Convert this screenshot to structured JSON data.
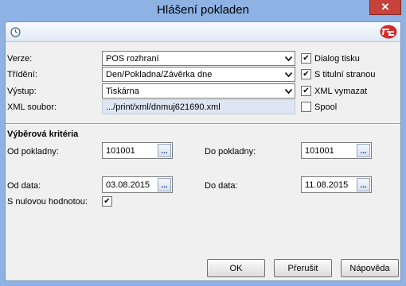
{
  "window": {
    "title": "Hlášení pokladen",
    "close_symbol": "✕"
  },
  "toolbar": {
    "clock_icon": "clock-icon",
    "logo_icon": "app-logo-icon"
  },
  "header_fields": {
    "verze": {
      "label": "Verze:",
      "value": "POS rozhraní"
    },
    "trideni": {
      "label": "Třídění:",
      "value": "Den/Pokladna/Závěrka dne"
    },
    "vystup": {
      "label": "Výstup:",
      "value": "Tiskárna"
    },
    "xml_soubor": {
      "label": "XML soubor:",
      "value": ".../print/xml/dnmuj621690.xml"
    }
  },
  "checkboxes": {
    "dialog_tisku": {
      "label": "Dialog tisku",
      "checked": true
    },
    "s_titulni_stranou": {
      "label": "S titulní stranou",
      "checked": true
    },
    "xml_vymazat": {
      "label": "XML vymazat",
      "checked": true
    },
    "spool": {
      "label": "Spool",
      "checked": false
    }
  },
  "criteria": {
    "title": "Výběrová kritéria",
    "od_pokladny": {
      "label": "Od pokladny:",
      "value": "101001"
    },
    "do_pokladny": {
      "label": "Do pokladny:",
      "value": "101001"
    },
    "od_data": {
      "label": "Od data:",
      "value": "03.08.2015"
    },
    "do_data": {
      "label": "Do data:",
      "value": "11.08.2015"
    },
    "s_nulovou_hodnotou": {
      "label": "S nulovou hodnotou:",
      "checked": true
    },
    "browse_symbol": "..."
  },
  "buttons": {
    "ok": "OK",
    "prerusit": "Přerušit",
    "napoveda": "Nápověda"
  },
  "check_symbol": "✔",
  "colors": {
    "title_bar": "#8db2e3",
    "close_button": "#c7423a",
    "readonly_field": "#dde6f2"
  }
}
